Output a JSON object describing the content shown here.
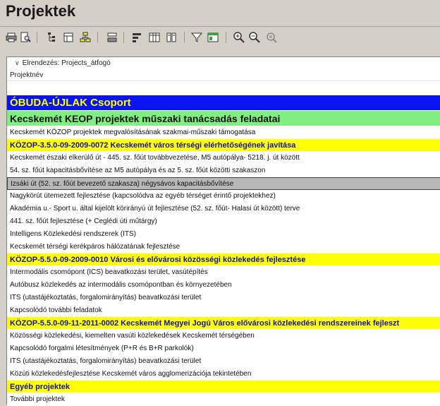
{
  "window": {
    "title": "Projektek"
  },
  "toolbar": {
    "buttons": [
      {
        "name": "print-icon"
      },
      {
        "name": "print-preview-icon"
      },
      {
        "name": "tree-view-icon"
      },
      {
        "name": "group-icon"
      },
      {
        "name": "hierarchy-icon"
      },
      {
        "name": "sum-icon"
      },
      {
        "name": "sort-icon"
      },
      {
        "name": "columns-icon"
      },
      {
        "name": "book-icon"
      },
      {
        "name": "filter-icon"
      },
      {
        "name": "filter-table-icon"
      },
      {
        "name": "zoom-in-icon"
      },
      {
        "name": "zoom-out-icon"
      },
      {
        "name": "zoom-fit-icon"
      }
    ]
  },
  "layout": {
    "label": "Elrendezés: Projects_átfogó"
  },
  "column_header": "Projektnév",
  "rows": [
    {
      "type": "group-blue",
      "text": "ÓBUDA-ÚJLAK Csoport"
    },
    {
      "type": "group-green",
      "text": "Kecskemét KEOP projektek műszaki tanácsadás feladatai"
    },
    {
      "type": "plain",
      "text": "Kecskemét KÖZOP projektek megvalósításának szakmai-műszaki támogatása"
    },
    {
      "type": "group-yellow",
      "text": "KÖZOP-3.5.0-09-2009-0072 Kecskemét város térségi elérhetőségének javítása"
    },
    {
      "type": "plain",
      "text": "Kecskemét északi elkerülő út - 445. sz. főút továbbvezetése, M5 autópálya- 5218. j. út között"
    },
    {
      "type": "plain",
      "text": "54. sz. főút kapacitásbővítése az M5 autópálya és az 5. sz. főút közötti szakaszon"
    },
    {
      "type": "selected",
      "text": "Izsáki út (52. sz. főút bevezető szakasza) négysávos kapacitásbővítése"
    },
    {
      "type": "plain",
      "text": "Nagykörút ütemezett fejlesztése (kapcsolódva az egyéb térséget érintő projektekhez)"
    },
    {
      "type": "plain",
      "text": "Akadémia u.- Sport u. által kijelölt körirányú út fejlesztése (52. sz. főút- Halasi út között) terve"
    },
    {
      "type": "plain",
      "text": "441. sz. főút fejlesztése (+ Ceglédi úti műtárgy)"
    },
    {
      "type": "plain",
      "text": "Intelligens Közlekedési rendszerek (ITS)"
    },
    {
      "type": "plain",
      "text": "Kecskemét térségi kerékpáros hálózatának fejlesztése"
    },
    {
      "type": "group-yellow",
      "text": "KÖZOP-5.5.0-09-2009-0010 Városi és elővárosi közösségi közlekedés fejlesztése"
    },
    {
      "type": "plain",
      "text": "Intermodális csomópont (ICS) beavatkozási terület, vasútépítés"
    },
    {
      "type": "plain",
      "text": "Autóbusz közlekedés az intermodális csomópontban és környezetében"
    },
    {
      "type": "plain",
      "text": "ITS (utastájékoztatás, forgalomirányítás) beavatkozási terület"
    },
    {
      "type": "plain",
      "text": "Kapcsolódó további feladatok"
    },
    {
      "type": "group-yellow",
      "text": "KÖZOP-5.5.0-09-11-2011-0002 Kecskemét Megyei Jogú Város elővárosi közlekedési rendszereinek fejleszt"
    },
    {
      "type": "plain",
      "text": "Közösségi közlekedési, kiemelten vasúti közlekedések Kecskemét térségében"
    },
    {
      "type": "plain",
      "text": "Kapcsolódó forgalmi létesítmények (P+R és B+R parkolók)"
    },
    {
      "type": "plain",
      "text": "ITS (utastájékoztatás, forgalomirányítás) beavatkozási terület"
    },
    {
      "type": "plain",
      "text": "Közúti közlekedésfejlesztése Kecskemét város agglomerizációja tekintetében"
    },
    {
      "type": "group-yellow",
      "text": "Egyéb projektek"
    },
    {
      "type": "plain",
      "text": "További projektek"
    }
  ]
}
